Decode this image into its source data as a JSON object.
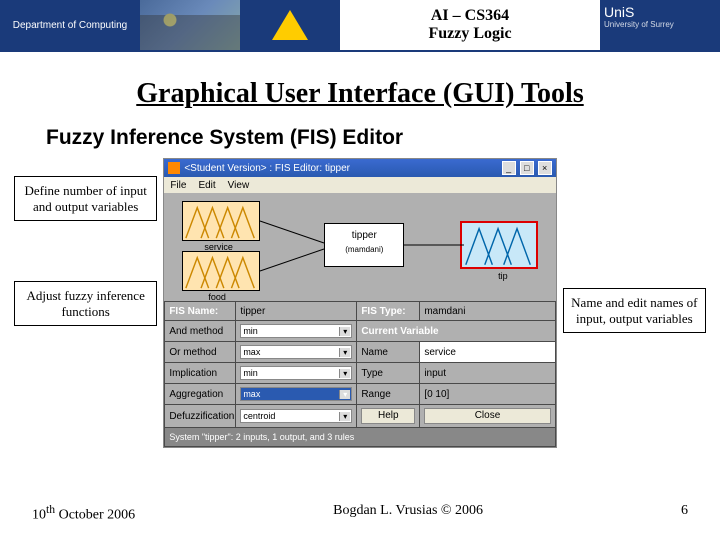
{
  "header": {
    "department": "Department of Computing",
    "course_code": "AI – CS364",
    "course_topic": "Fuzzy Logic",
    "university": "University of Surrey",
    "unis_logo": "UniS"
  },
  "slide": {
    "title": "Graphical User Interface (GUI) Tools",
    "section": "Fuzzy Inference System (FIS) Editor"
  },
  "callouts": {
    "define_io": "Define number of input and output variables",
    "adjust_functions": "Adjust fuzzy inference functions",
    "name_edit": "Name and edit names of input, output variables"
  },
  "fis": {
    "window_title": "<Student Version> : FIS Editor: tipper",
    "menu": {
      "file": "File",
      "edit": "Edit",
      "view": "View"
    },
    "diagram": {
      "input1_label": "service",
      "input2_label": "food",
      "system_name": "tipper",
      "system_type": "(mamdani)",
      "output_label": "tip"
    },
    "row_fis_name_label": "FIS Name:",
    "row_fis_name_value": "tipper",
    "row_fis_type_label": "FIS Type:",
    "row_fis_type_value": "mamdani",
    "left_params": {
      "and_label": "And method",
      "and_value": "min",
      "or_label": "Or method",
      "or_value": "max",
      "imp_label": "Implication",
      "imp_value": "min",
      "agg_label": "Aggregation",
      "agg_value": "max",
      "def_label": "Defuzzification",
      "def_value": "centroid"
    },
    "right_params": {
      "section": "Current Variable",
      "name_label": "Name",
      "name_value": "service",
      "type_label": "Type",
      "type_value": "input",
      "range_label": "Range",
      "range_value": "[0 10]",
      "help_btn": "Help",
      "close_btn": "Close"
    },
    "status": "System \"tipper\": 2 inputs, 1 output, and 3 rules"
  },
  "footer": {
    "date": "10th October 2006",
    "author": "Bogdan L. Vrusias © 2006",
    "page": "6"
  }
}
